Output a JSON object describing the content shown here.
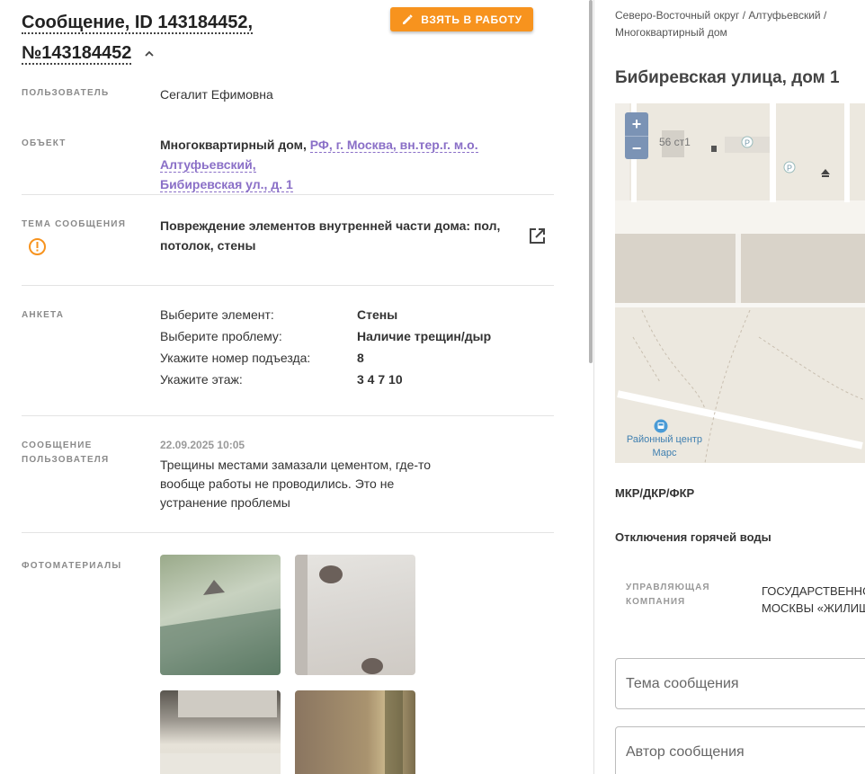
{
  "header": {
    "title_line1": "Сообщение, ID 143184452,",
    "title_line2": "№143184452",
    "take_button": "ВЗЯТЬ В РАБОТУ"
  },
  "details": {
    "user_label": "ПОЛЬЗОВАТЕЛЬ",
    "user_value": "Сегалит Ефимовна",
    "object_label": "ОБЪЕКТ",
    "object_type": "Многоквартирный дом,",
    "object_link_line1": "РФ, г. Москва, вн.тер.г. м.о. Алтуфьевский,",
    "object_link_line2": "Бибиревская ул., д. 1",
    "topic_label": "ТЕМА СООБЩЕНИЯ",
    "topic_line1": "Повреждение элементов внутренней части дома: пол,",
    "topic_line2": "потолок, стены",
    "form_label": "АНКЕТА",
    "form_rows": [
      {
        "q": "Выберите элемент:",
        "a": "Стены"
      },
      {
        "q": "Выберите проблему:",
        "a": "Наличие трещин/дыр"
      },
      {
        "q": "Укажите номер подъезда:",
        "a": "8"
      },
      {
        "q": "Укажите этаж:",
        "a": "3 4 7 10"
      }
    ],
    "message_label_line1": "СООБЩЕНИЕ",
    "message_label_line2": "ПОЛЬЗОВАТЕЛЯ",
    "message_date": "22.09.2025 10:05",
    "message_line1": "Трещины местами замазали цементом, где-то",
    "message_line2": "вообще работы не проводились. Это не",
    "message_line3": "устранение проблемы",
    "photos_label": "ФОТОМАТЕРИАЛЫ"
  },
  "right": {
    "breadcrumb_line1": "Северо-Восточный округ / Алтуфьевский /",
    "breadcrumb_line2": "Многоквартирный дом",
    "address": "Бибиревская улица, дом 1",
    "map": {
      "zoom_in": "+",
      "zoom_out": "−",
      "building_label": "56 ст1",
      "poi_line1": "Районный центр",
      "poi_line2": "Марс"
    },
    "section_mkr": "МКР/ДКР/ФКР",
    "section_hot_water": "Отключения горячей воды",
    "mc_label_line1": "УПРАВЛЯЮЩАЯ",
    "mc_label_line2": "КОМПАНИЯ",
    "mc_value_line1": "ГОСУДАРСТВЕННОЕ",
    "mc_value_line2": "МОСКВЫ «ЖИЛИЩНИК",
    "topic_placeholder": "Тема сообщения",
    "author_placeholder": "Автор сообщения"
  },
  "colors": {
    "accent_orange": "#f7931e",
    "link_purple": "#8a6fc7",
    "map_zoom": "#7b93b5"
  },
  "icons": [
    "pencil-icon",
    "chevron-up-icon",
    "warning-icon",
    "external-link-icon",
    "bus-stop-icon",
    "parking-icon"
  ]
}
